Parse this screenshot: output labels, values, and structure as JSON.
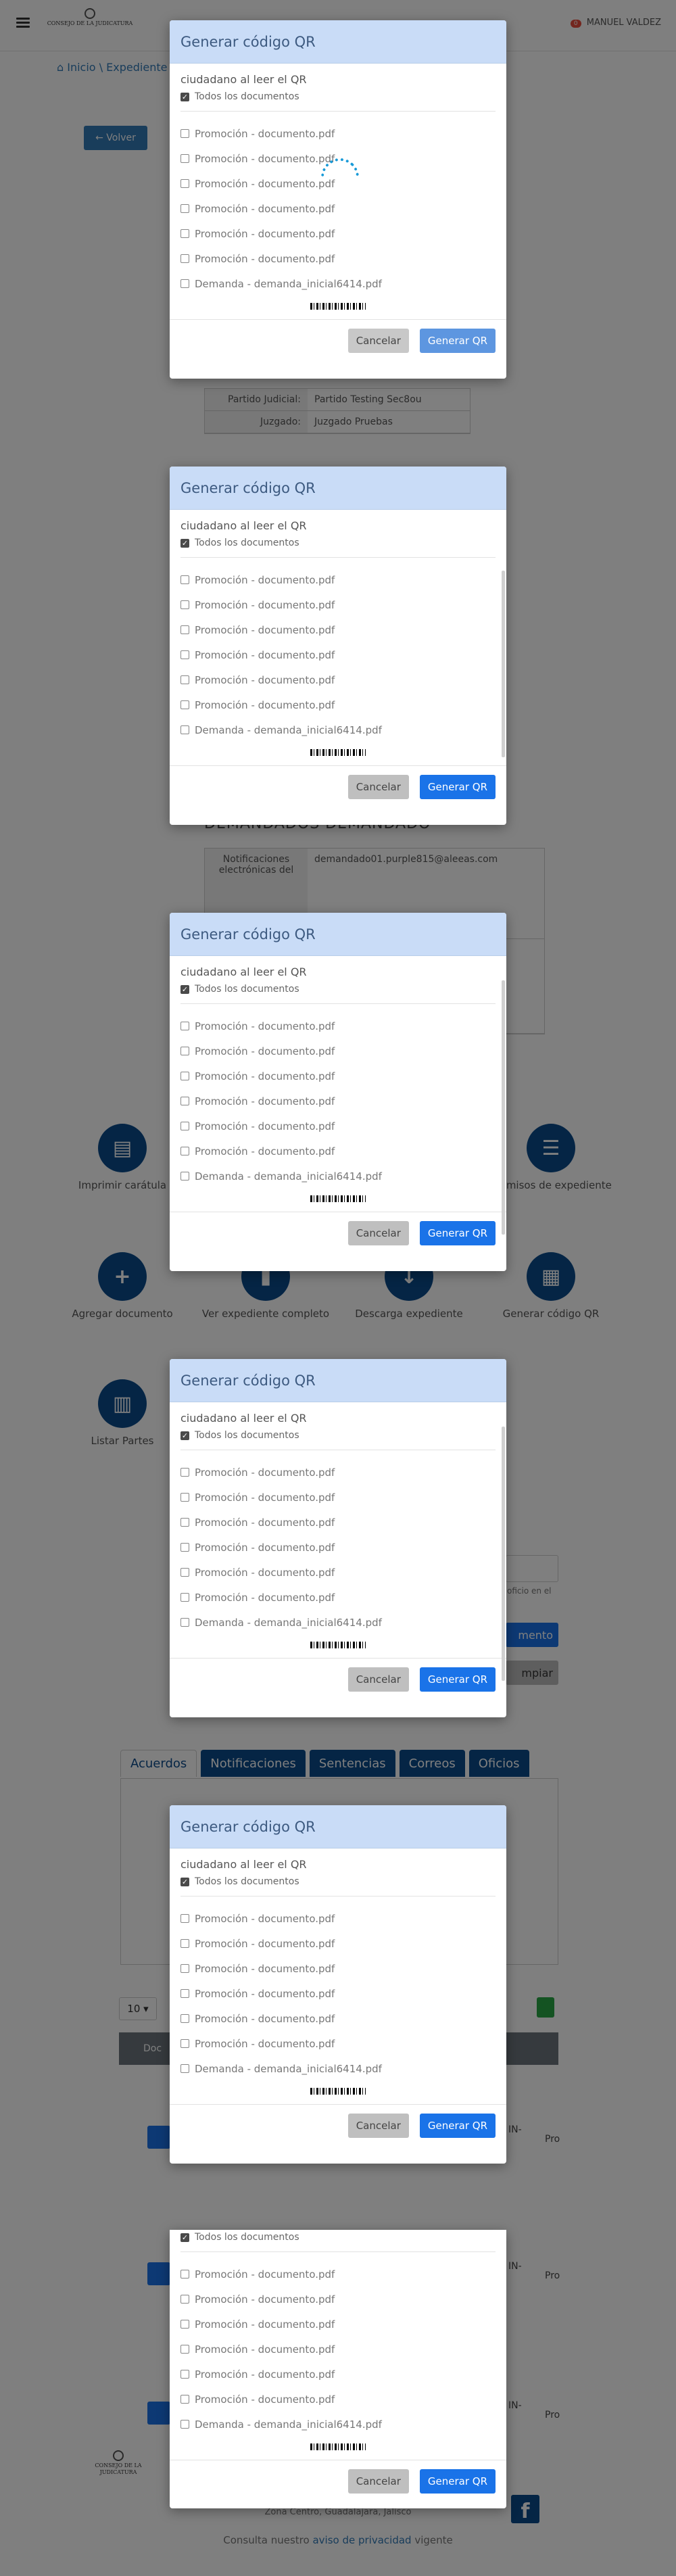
{
  "header": {
    "logo_text": "CONSEJO DE LA JUDICATURA",
    "user_label": "MANUEL VALDEZ",
    "notifications_count": "0"
  },
  "breadcrumb": {
    "home": "Inicio",
    "separator": "\\",
    "current": "Expediente"
  },
  "back_button": "Volver",
  "case_table": {
    "rows": [
      {
        "label": "Partido Judicial:",
        "value": "Partido Testing Sec8ou"
      },
      {
        "label": "Juzgado:",
        "value": "Juzgado Pruebas"
      }
    ]
  },
  "defendants": {
    "title": "DEMANDADOS DEMANDADO",
    "label": "Notificaciones electrónicas del",
    "email": "demandado01.purple815@aleeas.com"
  },
  "actions": [
    {
      "label": "Imprimir carátula"
    },
    {
      "label": "Permisos de expediente"
    },
    {
      "label": "Agregar documento"
    },
    {
      "label": "Ver expediente completo"
    },
    {
      "label": "Descarga expediente"
    },
    {
      "label": "Generar código QR"
    },
    {
      "label": "Listar Partes"
    }
  ],
  "search_hint": "oficio en el",
  "search_btn": "mento",
  "clear_btn": "mpiar",
  "tabs": [
    "Acuerdos",
    "Notificaciones",
    "Sentencias",
    "Correos",
    "Oficios"
  ],
  "table": {
    "page_size": "10",
    "header_first": "Doc",
    "cell_codes": [
      "IN-",
      "IN-",
      "IN-"
    ],
    "cell_suffix": "Pro"
  },
  "footer": {
    "address": "Zona Centro, Guadalajara, Jalisco",
    "privacy_prefix": "Consulta nuestro",
    "privacy_link": "aviso de privacidad",
    "privacy_suffix": "vigente"
  },
  "modal": {
    "title": "Generar código QR",
    "hint": "ciudadano al leer el QR",
    "select_all": "Todos los documentos",
    "documents": [
      "Promoción - documento.pdf",
      "Promoción - documento.pdf",
      "Promoción - documento.pdf",
      "Promoción - documento.pdf",
      "Promoción - documento.pdf",
      "Promoción - documento.pdf",
      "Demanda - demanda_inicial6414.pdf"
    ],
    "cancel": "Cancelar",
    "generate": "Generar QR"
  },
  "colors": {
    "primary": "#0b4a8b",
    "modal_header": "#c9dcf7",
    "generate_button": "#1a73e8"
  }
}
